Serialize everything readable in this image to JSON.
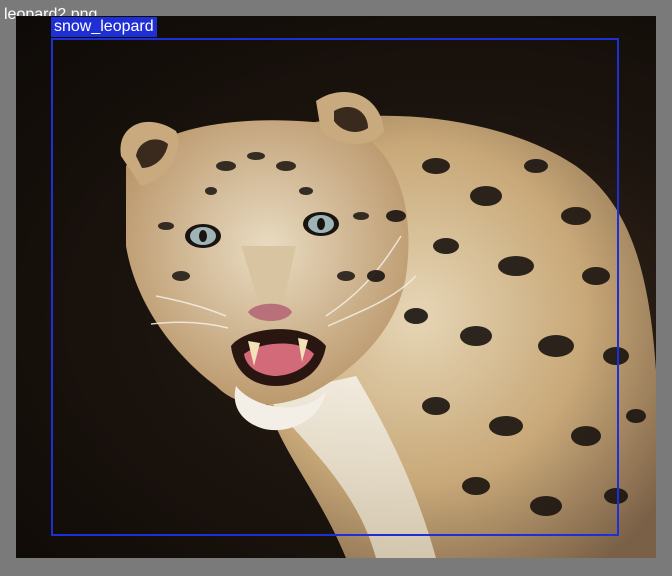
{
  "window": {
    "title": "leopard2.png"
  },
  "detection": {
    "label": "snow_leopard",
    "box_color": "#1f2fd6"
  },
  "image": {
    "subject": "snow leopard snarling, facing viewer",
    "palette": {
      "background": "#1c140e",
      "fur_light": "#e8dcc4",
      "fur_warm": "#c9ab7c",
      "spots": "#1a1410"
    }
  }
}
